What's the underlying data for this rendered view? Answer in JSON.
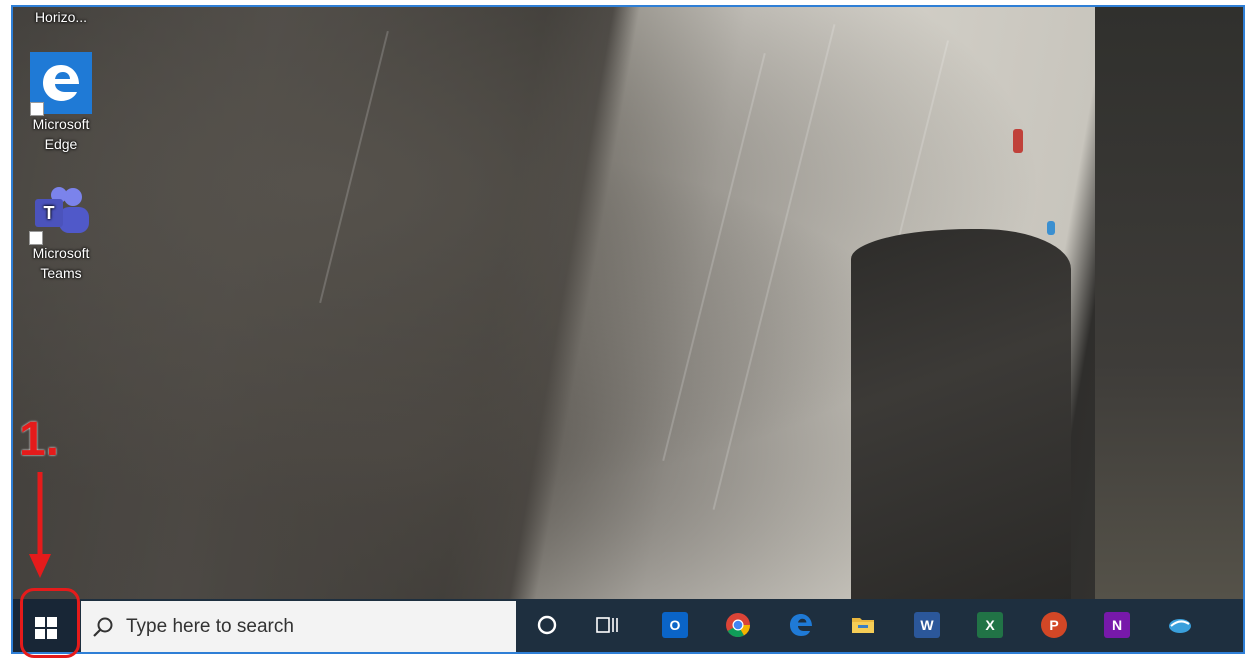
{
  "desktop": {
    "icons": [
      {
        "label_line1": "Horizo...",
        "icon": "horizon-icon"
      },
      {
        "label_line1": "Microsoft",
        "label_line2": "Edge",
        "icon": "edge-icon"
      },
      {
        "label_line1": "Microsoft",
        "label_line2": "Teams",
        "icon": "teams-icon"
      }
    ]
  },
  "annotation": {
    "step": "1."
  },
  "taskbar": {
    "start": {
      "icon": "windows-logo-icon"
    },
    "search": {
      "placeholder": "Type here to search",
      "icon": "search-icon"
    },
    "apps": [
      {
        "name": "cortana",
        "icon": "cortana-circle-icon",
        "running": false
      },
      {
        "name": "task-view",
        "icon": "task-view-icon",
        "running": false
      },
      {
        "name": "outlook",
        "icon": "outlook-icon",
        "letter": "O",
        "color": "#0a64c7",
        "running": false
      },
      {
        "name": "chrome",
        "icon": "chrome-icon",
        "running": true
      },
      {
        "name": "edge",
        "icon": "edge-icon",
        "running": false
      },
      {
        "name": "file-explorer",
        "icon": "folder-icon",
        "running": true
      },
      {
        "name": "word",
        "icon": "word-icon",
        "letter": "W",
        "color": "#2b579a",
        "running": true
      },
      {
        "name": "excel",
        "icon": "excel-icon",
        "letter": "X",
        "color": "#217346",
        "running": false
      },
      {
        "name": "powerpoint",
        "icon": "powerpoint-icon",
        "letter": "P",
        "color": "#d24726",
        "running": false
      },
      {
        "name": "onenote",
        "icon": "onenote-icon",
        "letter": "N",
        "color": "#7719aa",
        "running": false
      },
      {
        "name": "horizon",
        "icon": "horizon-client-icon",
        "running": true
      }
    ]
  },
  "colors": {
    "taskbar": "#1e2f3f",
    "accent_running": "#76b9ed",
    "annotation": "#e51b1b",
    "frame": "#2f7fd6"
  }
}
